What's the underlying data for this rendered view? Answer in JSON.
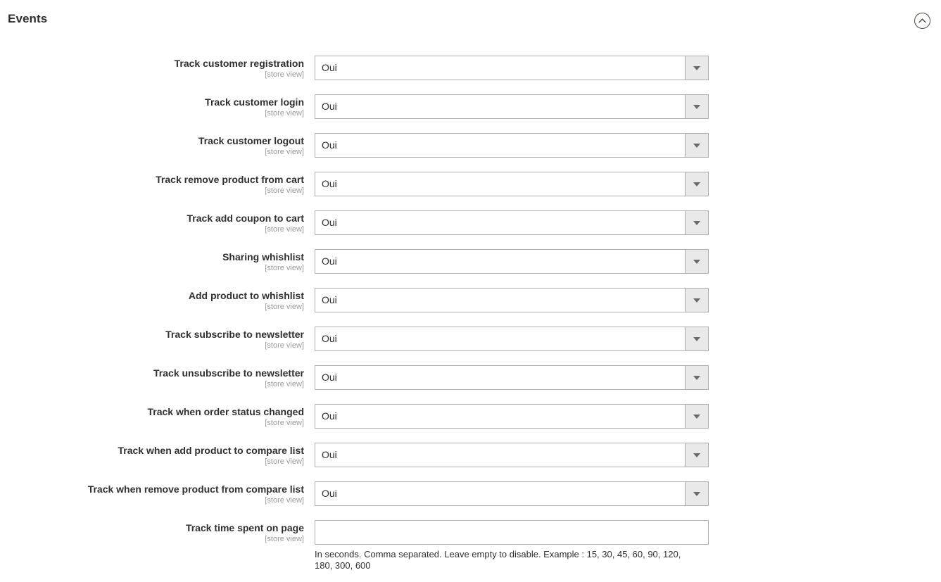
{
  "section": {
    "title": "Events",
    "collapse_icon": "chevron-up-circle-icon",
    "scope_note": "[store view]"
  },
  "fields": [
    {
      "label": "Track customer registration",
      "scope": "[store view]",
      "type": "select",
      "value": "Oui"
    },
    {
      "label": "Track customer login",
      "scope": "[store view]",
      "type": "select",
      "value": "Oui"
    },
    {
      "label": "Track customer logout",
      "scope": "[store view]",
      "type": "select",
      "value": "Oui"
    },
    {
      "label": "Track remove product from cart",
      "scope": "[store view]",
      "type": "select",
      "value": "Oui"
    },
    {
      "label": "Track add coupon to cart",
      "scope": "[store view]",
      "type": "select",
      "value": "Oui"
    },
    {
      "label": "Sharing whishlist",
      "scope": "[store view]",
      "type": "select",
      "value": "Oui"
    },
    {
      "label": "Add product to whishlist",
      "scope": "[store view]",
      "type": "select",
      "value": "Oui"
    },
    {
      "label": "Track subscribe to newsletter",
      "scope": "[store view]",
      "type": "select",
      "value": "Oui"
    },
    {
      "label": "Track unsubscribe to newsletter",
      "scope": "[store view]",
      "type": "select",
      "value": "Oui"
    },
    {
      "label": "Track when order status changed",
      "scope": "[store view]",
      "type": "select",
      "value": "Oui"
    },
    {
      "label": "Track when add product to compare list",
      "scope": "[store view]",
      "type": "select",
      "value": "Oui"
    },
    {
      "label": "Track when remove product from compare list",
      "scope": "[store view]",
      "type": "select",
      "value": "Oui"
    },
    {
      "label": "Track time spent on page",
      "scope": "[store view]",
      "type": "text",
      "value": "",
      "placeholder": "",
      "note": "In seconds. Comma separated. Leave empty to disable. Example : 15, 30, 45, 60, 90, 120, 180, 300, 600"
    }
  ]
}
